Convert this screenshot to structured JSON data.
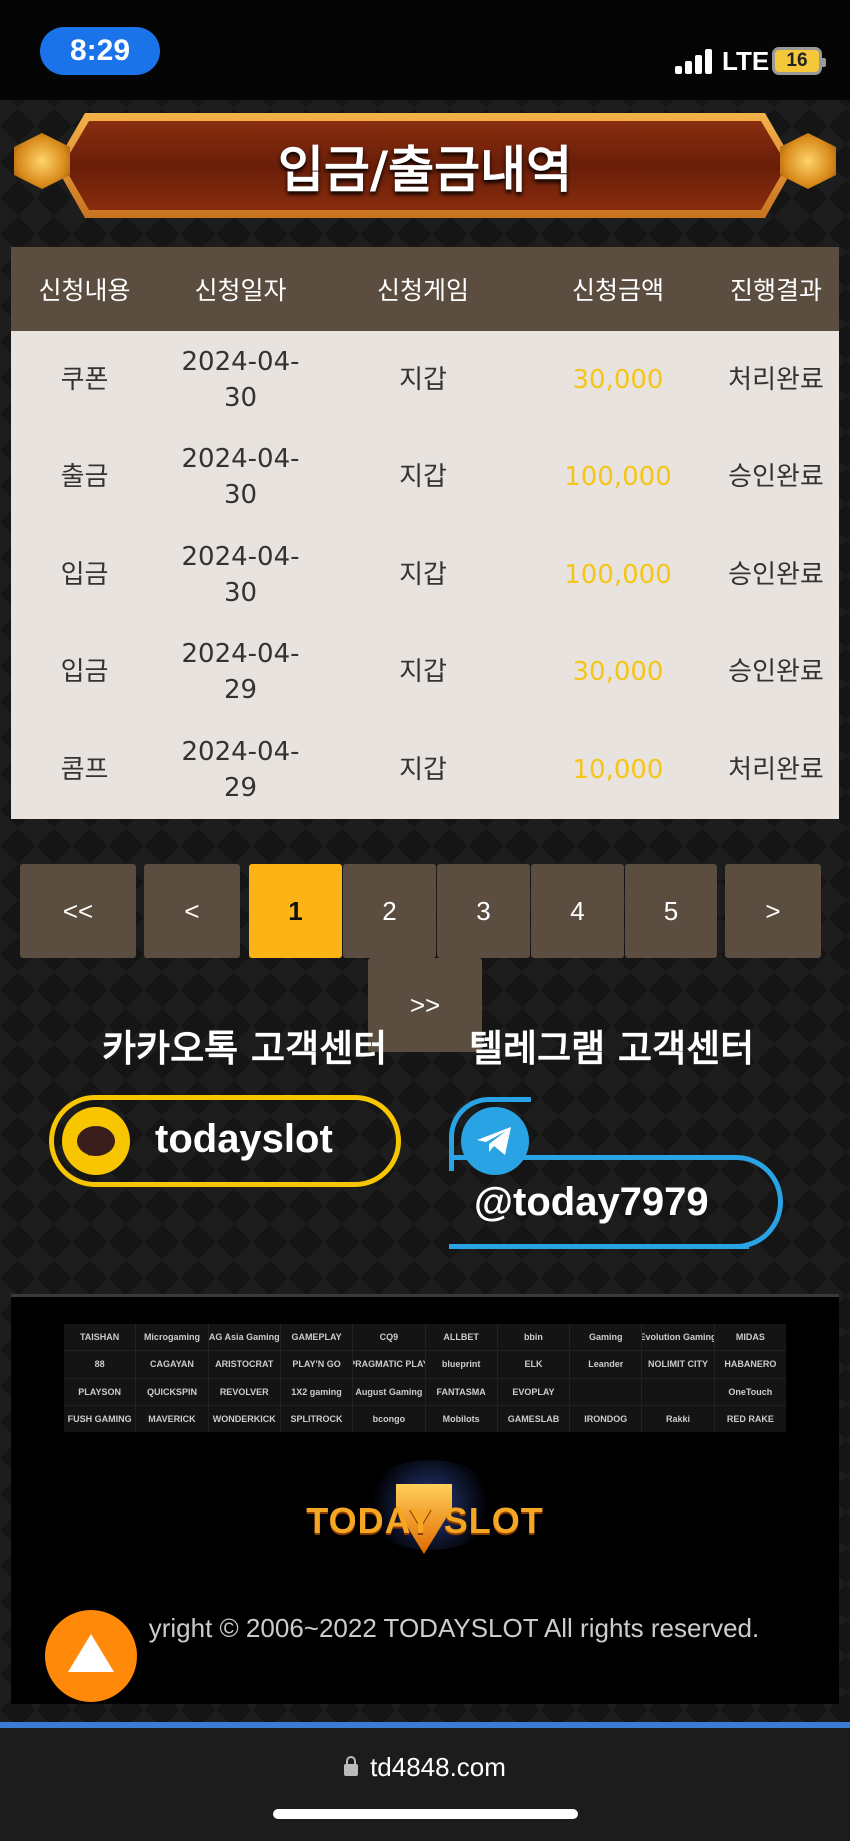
{
  "status_bar": {
    "time": "8:29",
    "network": "LTE",
    "battery": "16"
  },
  "page_title": "입금/출금내역",
  "table": {
    "headers": [
      "신청내용",
      "신청일자",
      "신청게임",
      "신청금액",
      "진행결과"
    ],
    "rows": [
      {
        "type": "쿠폰",
        "date": "2024-04-\n30",
        "game": "지갑",
        "amount": "30,000",
        "result": "처리완료"
      },
      {
        "type": "출금",
        "date": "2024-04-\n30",
        "game": "지갑",
        "amount": "100,000",
        "result": "승인완료"
      },
      {
        "type": "입금",
        "date": "2024-04-\n30",
        "game": "지갑",
        "amount": "100,000",
        "result": "승인완료"
      },
      {
        "type": "입금",
        "date": "2024-04-\n29",
        "game": "지갑",
        "amount": "30,000",
        "result": "승인완료"
      },
      {
        "type": "콤프",
        "date": "2024-04-\n29",
        "game": "지갑",
        "amount": "10,000",
        "result": "처리완료"
      }
    ]
  },
  "pagination": {
    "first": "<<",
    "prev": "<",
    "pages": [
      "1",
      "2",
      "3",
      "4",
      "5"
    ],
    "current": "1",
    "next": ">",
    "last": ">>"
  },
  "customer_center": {
    "kakao_title": "카카오톡 고객센터",
    "kakao_id": "todayslot",
    "telegram_title": "텔레그램 고객센터",
    "telegram_id": "@today7979"
  },
  "providers": [
    "TAISHAN",
    "Microgaming",
    "AG Asia Gaming",
    "GAMEPLAY",
    "CQ9",
    "ALLBET",
    "bbin",
    "Gaming",
    "Evolution Gaming",
    "MIDAS",
    "88",
    "CAGAYAN",
    "ARISTOCRAT",
    "PLAY'N GO",
    "PRAGMATIC PLAY",
    "blueprint",
    "ELK",
    "Leander",
    "NOLIMIT CITY",
    "HABANERO",
    "PLAYSON",
    "QUICKSPIN",
    "REVOLVER",
    "1X2 gaming",
    "August Gaming",
    "FANTASMA",
    "EVOPLAY",
    "",
    "",
    "OneTouch",
    "FUSH GAMING",
    "MAVERICK",
    "WONDERKICK",
    "SPLITROCK",
    "bcongo",
    "Mobilots",
    "GAMESLAB",
    "IRONDOG",
    "Rakki",
    "RED RAKE"
  ],
  "brand_logo": "TODAY SLOT",
  "copyright": "yright © 2006~2022 TODAYSLOT All rights reserved.",
  "browser": {
    "url": "td4848.com"
  }
}
